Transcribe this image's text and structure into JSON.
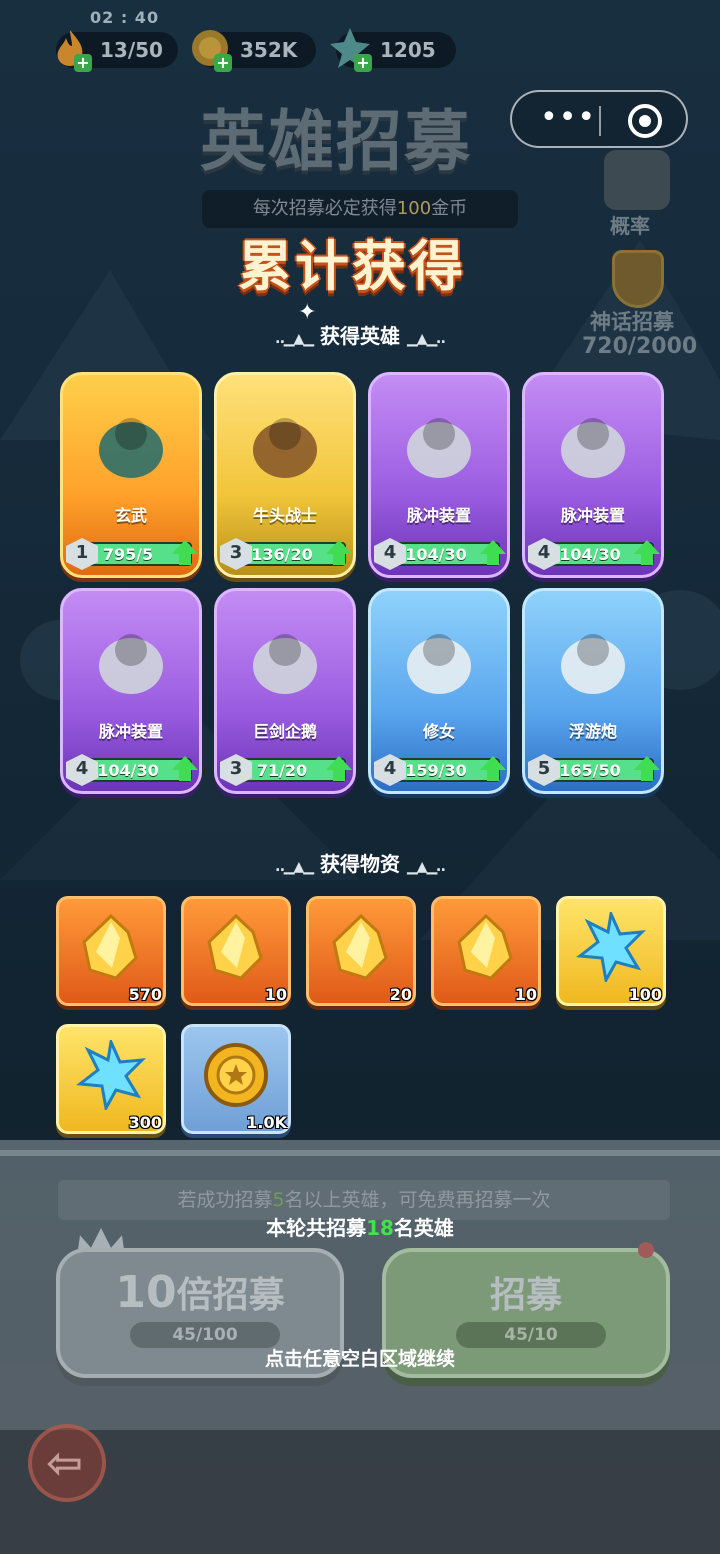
{
  "status": {
    "time": "02 : 40"
  },
  "resources": [
    {
      "icon": "energy-flame-icon",
      "value": "13/50"
    },
    {
      "icon": "gold-coin-icon",
      "value": "352K"
    },
    {
      "icon": "crystal-icon",
      "value": "1205"
    }
  ],
  "page": {
    "title": "英雄招募",
    "subtitle_pre": "每次招募必定获得",
    "subtitle_num": "100",
    "subtitle_post": "金币"
  },
  "side": {
    "probability_label": "概率",
    "myth_label": "神话招募",
    "myth_count": "720/2000"
  },
  "results": {
    "title": "累计获得",
    "heroes_section": "获得英雄",
    "items_section": "获得物资",
    "heroes": [
      {
        "name": "玄武",
        "level": "1",
        "progress": "795/5",
        "fill": 1.0,
        "rarity": "orange"
      },
      {
        "name": "牛头战士",
        "level": "3",
        "progress": "136/20",
        "fill": 1.0,
        "rarity": "gold"
      },
      {
        "name": "脉冲装置",
        "level": "4",
        "progress": "104/30",
        "fill": 1.0,
        "rarity": "purple"
      },
      {
        "name": "脉冲装置",
        "level": "4",
        "progress": "104/30",
        "fill": 1.0,
        "rarity": "purple"
      },
      {
        "name": "脉冲装置",
        "level": "4",
        "progress": "104/30",
        "fill": 1.0,
        "rarity": "purple"
      },
      {
        "name": "巨剑企鹅",
        "level": "3",
        "progress": "71/20",
        "fill": 1.0,
        "rarity": "purple"
      },
      {
        "name": "修女",
        "level": "4",
        "progress": "159/30",
        "fill": 1.0,
        "rarity": "blue"
      },
      {
        "name": "浮游炮",
        "level": "5",
        "progress": "165/50",
        "fill": 1.0,
        "rarity": "blue"
      }
    ],
    "items": [
      {
        "icon": "gold-crystal-icon",
        "qty": "570",
        "tier": "orange"
      },
      {
        "icon": "gold-crystal-icon",
        "qty": "10",
        "tier": "orange"
      },
      {
        "icon": "gold-crystal-icon",
        "qty": "20",
        "tier": "orange"
      },
      {
        "icon": "gold-crystal-icon",
        "qty": "10",
        "tier": "orange"
      },
      {
        "icon": "blue-snowflake-crystal-icon",
        "qty": "100",
        "tier": "gold"
      },
      {
        "icon": "blue-snowflake-crystal-icon",
        "qty": "300",
        "tier": "gold"
      },
      {
        "icon": "gold-coin-icon",
        "qty": "1.0K",
        "tier": "blue"
      }
    ]
  },
  "bottom": {
    "tip_pre": "若成功招募",
    "tip_num": "5",
    "tip_post": "名以上英雄，可免费再招募一次",
    "round_pre": "本轮共招募",
    "round_num": "18",
    "round_post": "名英雄",
    "ten_num": "10",
    "ten_label": "倍招募",
    "ten_cost": "45/100",
    "one_label": "招募",
    "one_cost": "45/10",
    "continue": "点击任意空白区域继续"
  },
  "colors": {
    "orange": "#ffa12a",
    "gold": "#f1c53a",
    "purple": "#9a5ce0",
    "blue": "#5aa6ee",
    "progress_green": "#57e08a",
    "highlight_green": "#40e34a",
    "title_shadow": "#c4521a"
  }
}
